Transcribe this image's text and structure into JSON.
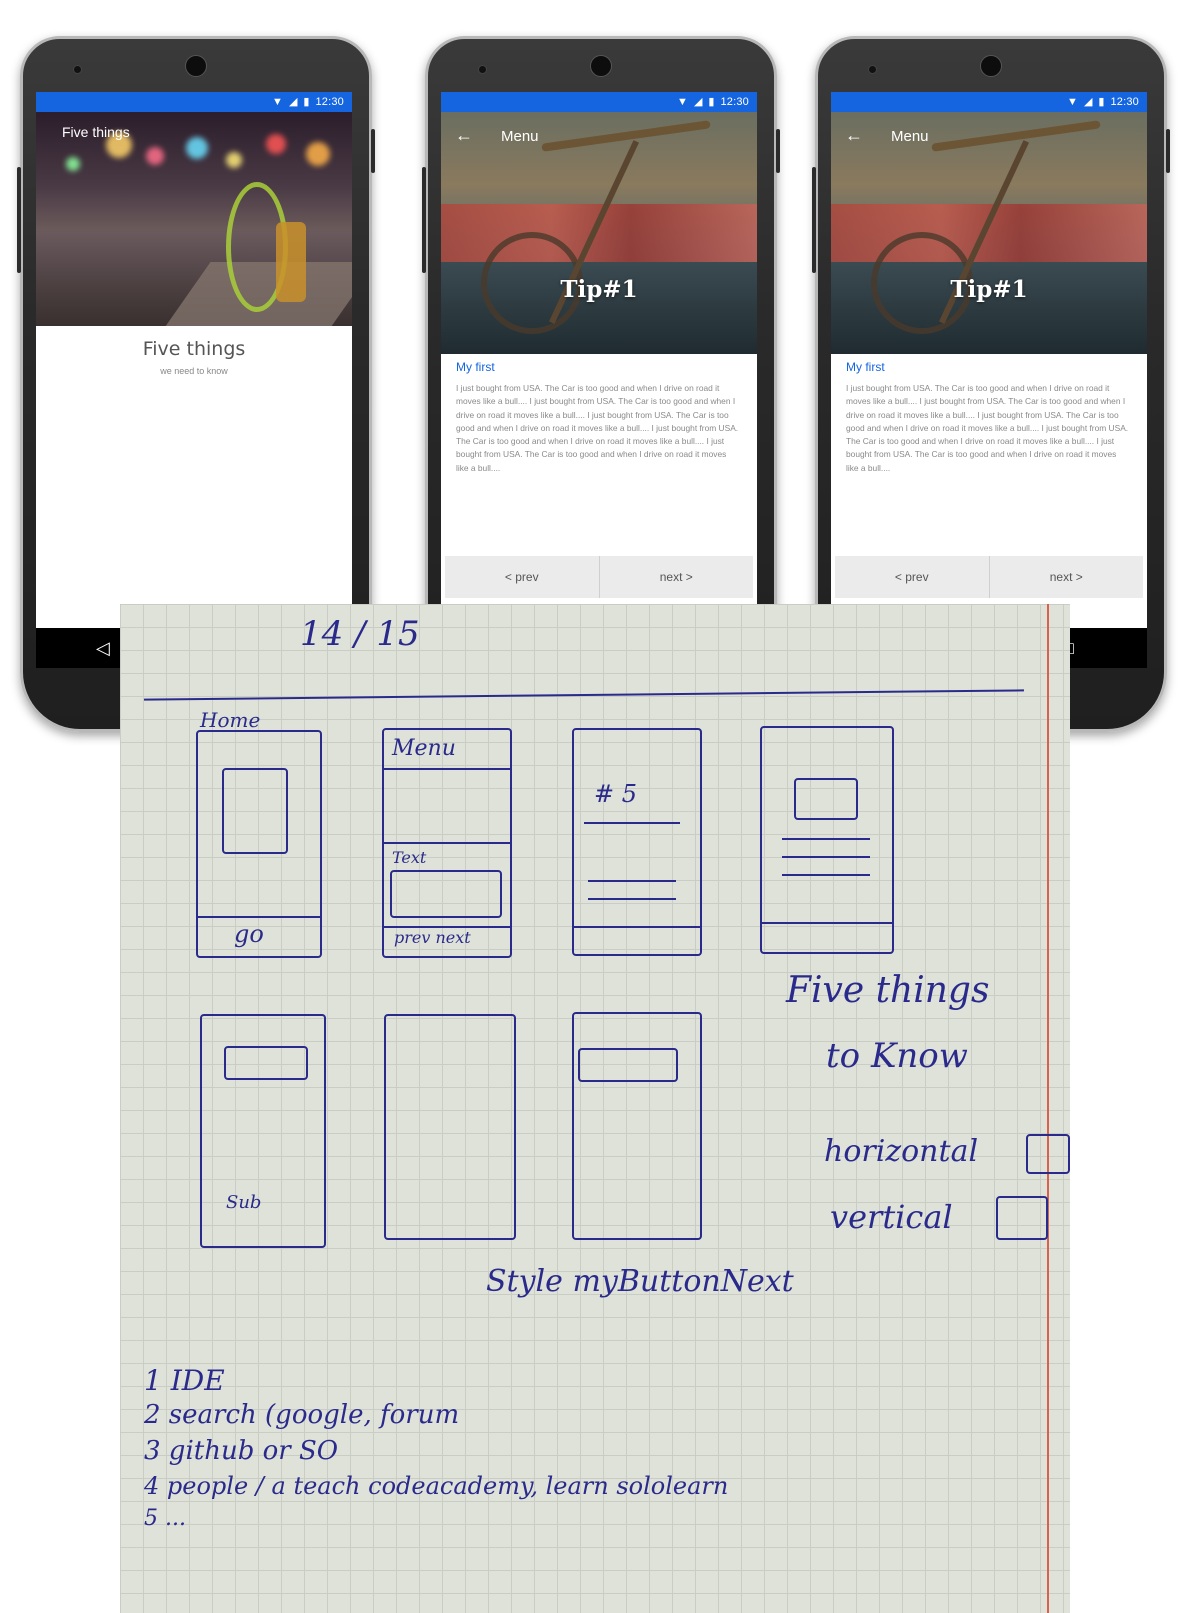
{
  "phones": [
    {
      "status": {
        "time": "12:30"
      },
      "hero_title": "Five things",
      "title": "Five things",
      "subtitle": "we need to know"
    },
    {
      "status": {
        "time": "12:30"
      },
      "toolbar_title": "Menu",
      "hero_title": "Tip#1",
      "section_heading": "My first",
      "body": "I just bought from USA. The Car is too good and when I drive on road it moves like a bull.... I just bought from USA. The Car is too good and when I drive on road it moves like a bull.... I just bought from USA. The Car is too good and when I drive on road it moves like a bull.... I just bought from USA. The Car is too good and when I drive on road it moves like a bull.... I just bought from USA. The Car is too good and when I drive on road it moves like a bull....",
      "prev_label": "< prev",
      "next_label": "next >"
    },
    {
      "status": {
        "time": "12:30"
      },
      "toolbar_title": "Menu",
      "hero_title": "Tip#1",
      "section_heading": "My first",
      "body": "I just bought from USA. The Car is too good and when I drive on road it moves like a bull.... I just bought from USA. The Car is too good and when I drive on road it moves like a bull.... I just bought from USA. The Car is too good and when I drive on road it moves like a bull.... I just bought from USA. The Car is too good and when I drive on road it moves like a bull.... I just bought from USA. The Car is too good and when I drive on road it moves like a bull....",
      "prev_label": "< prev",
      "next_label": "next >"
    }
  ],
  "sketch": {
    "date": "14 / 15",
    "wireframes": {
      "home_label": "Home",
      "home_button": "go",
      "menu_label": "Menu",
      "text_label": "Text",
      "prev_next": "prev next",
      "tip_number": "# 5",
      "submit": "Sub"
    },
    "notes": {
      "five_things": "Five things",
      "to_know": "to Know",
      "horizontal": "horizontal",
      "vertical": "vertical",
      "style": "Style myButtonNext"
    },
    "list": [
      "1  IDE",
      "2  search (google, forum",
      "3  github or SO",
      "4  people / a teach   codeacademy,  learn   sololearn",
      "5  ..."
    ]
  },
  "colors": {
    "accent": "#1565e0",
    "ink": "#2a2a8c",
    "margin": "#d9604d"
  }
}
